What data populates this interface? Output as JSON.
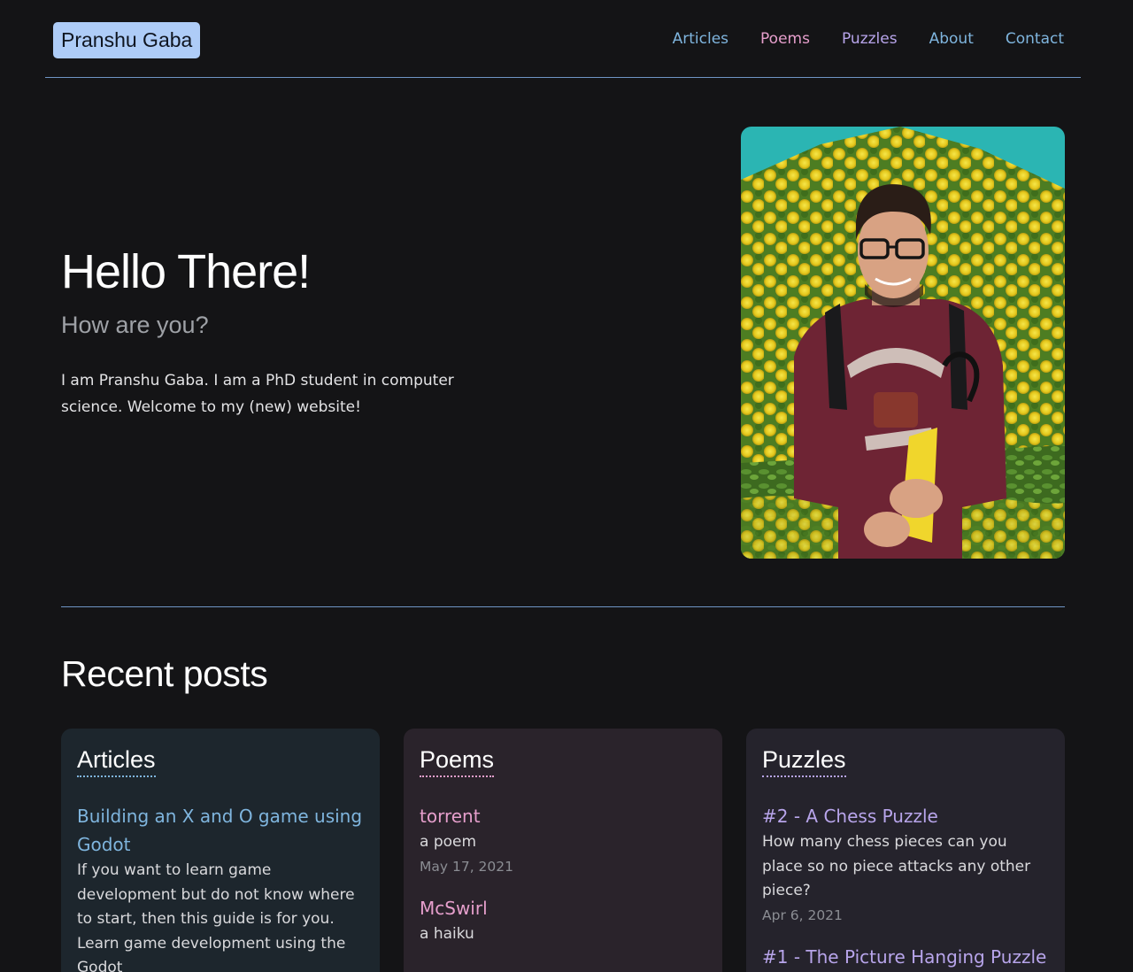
{
  "colors": {
    "background": "#141416",
    "accent_blue": "#7fb5de",
    "accent_pink": "#e69fcc",
    "accent_purple": "#b8a5eb",
    "brand_bg": "#aeccf7",
    "divider": "#6f95c4"
  },
  "header": {
    "brand": "Pranshu Gaba",
    "nav": [
      {
        "label": "Articles",
        "color": "#7fb5de"
      },
      {
        "label": "Poems",
        "color": "#e69fcc"
      },
      {
        "label": "Puzzles",
        "color": "#b8a5eb"
      },
      {
        "label": "About",
        "color": "#7fb5de"
      },
      {
        "label": "Contact",
        "color": "#7fb5de"
      }
    ]
  },
  "hero": {
    "title": "Hello There!",
    "subtitle": "How are you?",
    "body": "I am Pranshu Gaba. I am a PhD student in computer science. Welcome to my (new) website!"
  },
  "recent": {
    "title": "Recent posts",
    "cards": [
      {
        "heading": "Articles",
        "accent": "#7fb5de",
        "bg": "#1d262d",
        "posts": [
          {
            "title": "Building an X and O game using Godot",
            "desc": "If you want to learn game development but do not know where to start, then this guide is for you. Learn game development using the Godot",
            "date": ""
          }
        ]
      },
      {
        "heading": "Poems",
        "accent": "#e69fcc",
        "bg": "#2a232b",
        "posts": [
          {
            "title": "torrent",
            "desc": "a poem",
            "date": "May 17, 2021"
          },
          {
            "title": "McSwirl",
            "desc": "a haiku",
            "date": ""
          }
        ]
      },
      {
        "heading": "Puzzles",
        "accent": "#b8a5eb",
        "bg": "#25232c",
        "posts": [
          {
            "title": "#2 - A Chess Puzzle",
            "desc": "How many chess pieces can you place so no piece attacks any other piece?",
            "date": "Apr 6, 2021"
          },
          {
            "title": "#1 - The Picture Hanging Puzzle",
            "desc": "",
            "date": ""
          }
        ]
      }
    ]
  }
}
